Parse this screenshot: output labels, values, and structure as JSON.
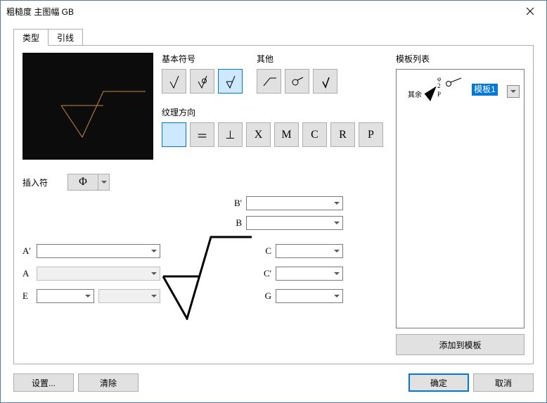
{
  "window": {
    "title": "粗糙度 主图幅 GB"
  },
  "tabs": {
    "t0": "类型",
    "t1": "引线",
    "active": 0
  },
  "groups": {
    "basic": {
      "title": "基本符号"
    },
    "other": {
      "title": "其他"
    },
    "texture": {
      "title": "纹理方向"
    },
    "template": {
      "title": "模板列表"
    }
  },
  "insert": {
    "label": "插入符",
    "symbol": "Φ"
  },
  "basic_icons": [
    "check1",
    "check-circle",
    "check-bar"
  ],
  "other_icons": [
    "angle",
    "circle-line",
    "check-small"
  ],
  "texture_options": [
    "blank",
    "＝",
    "⊥",
    "X",
    "M",
    "C",
    "R",
    "P"
  ],
  "fields": {
    "Bp": {
      "label": "B'",
      "value": ""
    },
    "B": {
      "label": "B",
      "value": ""
    },
    "Ap": {
      "label": "A'",
      "value": ""
    },
    "A": {
      "label": "A",
      "value": "",
      "disabled": true
    },
    "E1": {
      "label": "E",
      "value": ""
    },
    "E2": {
      "label": "",
      "value": "",
      "disabled": true
    },
    "C": {
      "label": "C",
      "value": ""
    },
    "Cp": {
      "label": "C'",
      "value": ""
    },
    "G": {
      "label": "G",
      "value": ""
    }
  },
  "template_list": {
    "items": [
      {
        "label": "模板1",
        "glyph_top": "φ",
        "glyph_mid": "2",
        "glyph_bottom": "P",
        "left_text": "其余"
      }
    ]
  },
  "buttons": {
    "add_template": "添加到模板",
    "settings": "设置...",
    "clear": "清除",
    "ok": "确定",
    "cancel": "取消"
  }
}
